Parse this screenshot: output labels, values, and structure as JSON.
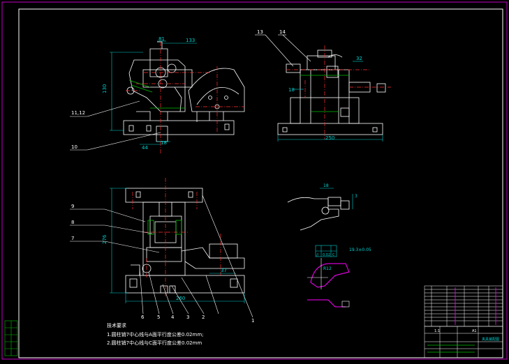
{
  "drawing": {
    "dims": {
      "top_width": "133",
      "top_offset": "81",
      "top_height": "130",
      "base_44": "44",
      "base_18": "18",
      "side_width": "250",
      "side_32": "32",
      "side_18": "18",
      "front_height": "276",
      "front_width": "260",
      "front_37": "37",
      "detail_18": "18",
      "detail_3": "3",
      "detail_range": "19.3±0.05",
      "detail_r": "R12"
    },
    "part_labels": [
      "1",
      "2",
      "3",
      "4",
      "5",
      "6",
      "7",
      "8",
      "9",
      "10",
      "11,12",
      "13",
      "14"
    ],
    "notes": {
      "heading": "技术要求",
      "line1": "1.圆柱销7中心线与A面平行度公差0.02mm;",
      "line2": "2.圆柱销7中心线与C面平行度公差0.02mm"
    },
    "tolerance_box": {
      "sym": "//",
      "val": "0.02",
      "ref": "C"
    },
    "title_block": {
      "title": "夹具装配图",
      "scale": "1:1",
      "sheet": "A1"
    }
  },
  "colors": {
    "line": "#ffffff",
    "red": "#ff3030",
    "green": "#00c000",
    "cyan": "#00d0d0",
    "magenta": "#ff00ff",
    "yellow": "#ffff00",
    "frame": "#c000c0"
  }
}
